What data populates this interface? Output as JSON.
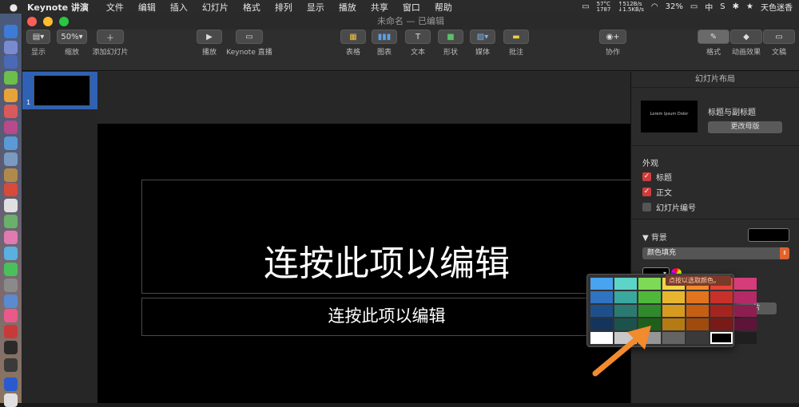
{
  "menubar": {
    "app_name": "Keynote 讲演",
    "items": [
      "文件",
      "编辑",
      "插入",
      "幻灯片",
      "格式",
      "排列",
      "显示",
      "播放",
      "共享",
      "窗口",
      "帮助"
    ],
    "status": {
      "temp": "57°C",
      "fan": "1787",
      "net_up": "↑512B/s",
      "net_down": "↓1.5KB/s",
      "battery": "32%",
      "input_method": "中",
      "user": "天色迷香"
    }
  },
  "window": {
    "title": "未命名 — 已编辑"
  },
  "toolbar": {
    "view_label": "显示",
    "zoom_value": "50%",
    "zoom_label": "缩放",
    "add_slide_label": "添加幻灯片",
    "play_label": "播放",
    "keynote_live_label": "Keynote 直播",
    "table_label": "表格",
    "chart_label": "图表",
    "text_label": "文本",
    "shape_label": "形状",
    "media_label": "媒体",
    "comment_label": "批注",
    "collaborate_label": "协作",
    "format_label": "格式",
    "animate_label": "动画效果",
    "document_label": "文稿"
  },
  "navigator": {
    "slide_number": "1"
  },
  "slide": {
    "title_placeholder": "连按此项以编辑",
    "subtitle_placeholder": "连按此项以编辑"
  },
  "inspector": {
    "header": "幻灯片布局",
    "layout_thumb_text": "Lorem Ipsum Dolor",
    "layout_name": "标题与副标题",
    "change_master": "更改母版",
    "appearance_label": "外观",
    "checkboxes": [
      {
        "label": "标题",
        "checked": true
      },
      {
        "label": "正文",
        "checked": true
      },
      {
        "label": "幻灯片编号",
        "checked": false
      }
    ],
    "background_label": "背景",
    "fill_type": "颜色填充",
    "hidden_button_text": "片"
  },
  "color_popup": {
    "tooltip": "点按以选取颜色。",
    "rows": [
      [
        "#4aa3f0",
        "#5dd4c8",
        "#7ed957",
        "#f3d34a",
        "#f08a2c",
        "#e8423a",
        "#d43c7a"
      ],
      [
        "#2f73c2",
        "#3aa89e",
        "#4fb83a",
        "#e8b52e",
        "#e2741e",
        "#c8302a",
        "#b32a66"
      ],
      [
        "#1f4f8a",
        "#2a7a72",
        "#2e8a2a",
        "#d69a1e",
        "#c65e14",
        "#a4241f",
        "#8c1e50"
      ],
      [
        "#14345e",
        "#1c524c",
        "#1f5f1c",
        "#b47a14",
        "#a04a0e",
        "#7a1a16",
        "#5e1438"
      ],
      [
        "#ffffff",
        "#c8c8c8",
        "#969696",
        "#646464",
        "#3a3a3a",
        "#000000",
        "#1f1f1f"
      ]
    ],
    "selected": "#000000",
    "arrow_color": "#f28a2e"
  },
  "colors": {
    "accent_blue": "#2f62b4",
    "checkbox_red": "#d23b3b",
    "select_orange": "#e0622d"
  }
}
